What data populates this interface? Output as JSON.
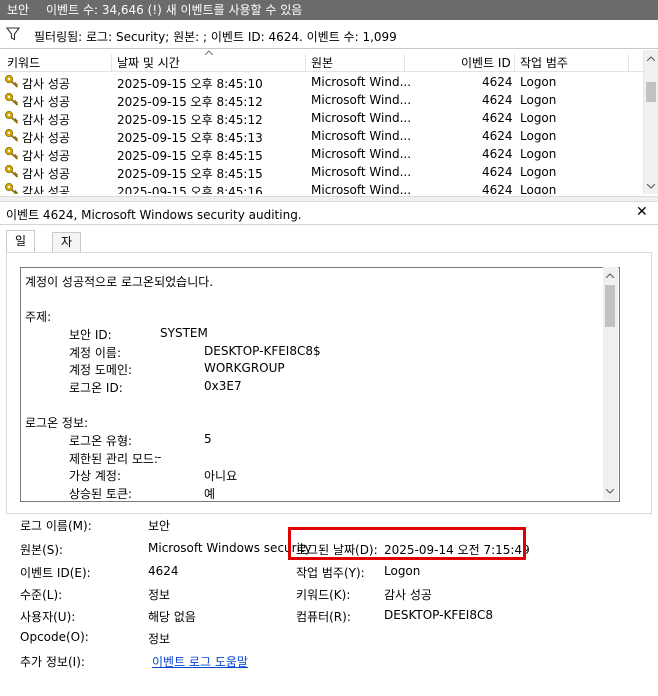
{
  "title_bar": {
    "name": "보안",
    "count_text": "이벤트 수: 34,646 (!) 새 이벤트를 사용할 수 있음"
  },
  "filter": {
    "text": "필터링됨: 로그: Security; 원본: ; 이벤트 ID: 4624. 이벤트 수: 1,099"
  },
  "columns": [
    "키워드",
    "날짜 및 시간",
    "원본",
    "이벤트 ID",
    "작업 범주"
  ],
  "rows": [
    {
      "keyword": "감사 성공",
      "datetime": "2025-09-15 오후 8:45:10",
      "source": "Microsoft Wind...",
      "event_id": "4624",
      "category": "Logon"
    },
    {
      "keyword": "감사 성공",
      "datetime": "2025-09-15 오후 8:45:12",
      "source": "Microsoft Wind...",
      "event_id": "4624",
      "category": "Logon"
    },
    {
      "keyword": "감사 성공",
      "datetime": "2025-09-15 오후 8:45:12",
      "source": "Microsoft Wind...",
      "event_id": "4624",
      "category": "Logon"
    },
    {
      "keyword": "감사 성공",
      "datetime": "2025-09-15 오후 8:45:13",
      "source": "Microsoft Wind...",
      "event_id": "4624",
      "category": "Logon"
    },
    {
      "keyword": "감사 성공",
      "datetime": "2025-09-15 오후 8:45:15",
      "source": "Microsoft Wind...",
      "event_id": "4624",
      "category": "Logon"
    },
    {
      "keyword": "감사 성공",
      "datetime": "2025-09-15 오후 8:45:15",
      "source": "Microsoft Wind...",
      "event_id": "4624",
      "category": "Logon"
    },
    {
      "keyword": "감사 성공",
      "datetime": "2025-09-15 오후 8:45:16",
      "source": "Microsoft Wind...",
      "event_id": "4624",
      "category": "Logon"
    }
  ],
  "event_title": "이벤트 4624, Microsoft Windows security auditing.",
  "tabs": [
    "일반",
    "자세히"
  ],
  "description": {
    "intro": "계정이 성공적으로 로그온되었습니다.",
    "subject_header": "주제:",
    "subject": [
      {
        "label": "보안 ID:",
        "value": "SYSTEM"
      },
      {
        "label": "계정 이름:",
        "value": "DESKTOP-KFEI8C8$"
      },
      {
        "label": "계정 도메인:",
        "value": "WORKGROUP"
      },
      {
        "label": "로그온 ID:",
        "value": "0x3E7"
      }
    ],
    "logon_header": "로그온 정보:",
    "logon": [
      {
        "label": "로그온 유형:",
        "value": "5"
      },
      {
        "label": "제한된 관리 모드:",
        "value": "-"
      },
      {
        "label": "가상 계정:",
        "value": "아니요"
      },
      {
        "label": "상승된 토큰:",
        "value": "예"
      }
    ]
  },
  "properties": {
    "log_name": {
      "label": "로그 이름(M):",
      "value": "보안"
    },
    "source": {
      "label": "원본(S):",
      "value": "Microsoft Windows security"
    },
    "logged": {
      "label": "로그된 날짜(D):",
      "value": "2025-09-14 오전 7:15:49"
    },
    "event_id": {
      "label": "이벤트 ID(E):",
      "value": "4624"
    },
    "task_category": {
      "label": "작업 범주(Y):",
      "value": "Logon"
    },
    "level": {
      "label": "수준(L):",
      "value": "정보"
    },
    "keywords": {
      "label": "키워드(K):",
      "value": "감사 성공"
    },
    "user": {
      "label": "사용자(U):",
      "value": "해당 없음"
    },
    "computer": {
      "label": "컴퓨터(R):",
      "value": "DESKTOP-KFEI8C8"
    },
    "opcode": {
      "label": "Opcode(O):",
      "value": "정보"
    },
    "more_info": {
      "label": "추가 정보(I):",
      "value": "이벤트 로그 도움말"
    }
  },
  "colors": {
    "highlight": "#e00000",
    "link": "#0645d6",
    "titlebar": "#6b6b6b"
  }
}
